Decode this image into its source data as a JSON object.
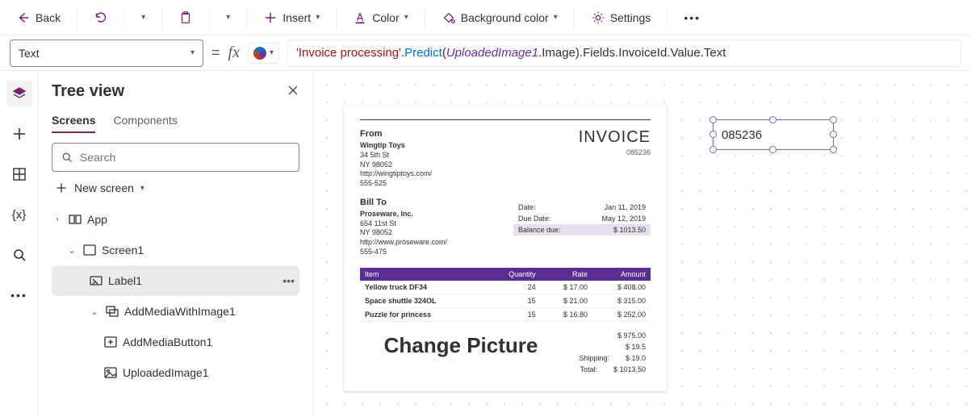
{
  "toolbar": {
    "back": "Back",
    "insert": "Insert",
    "color": "Color",
    "bgcolor": "Background color",
    "settings": "Settings"
  },
  "formula": {
    "property": "Text",
    "str": "'Invoice processing'",
    "dot1": ".",
    "fn": "Predict",
    "open": "(",
    "var": "UploadedImage1",
    "rest": ".Image).Fields.InvoiceId.Value.Text"
  },
  "panel": {
    "title": "Tree view",
    "tab_screens": "Screens",
    "tab_components": "Components",
    "search_placeholder": "Search",
    "new_screen": "New screen"
  },
  "tree": {
    "app": "App",
    "screen1": "Screen1",
    "label1": "Label1",
    "addmedia": "AddMediaWithImage1",
    "addbutton": "AddMediaButton1",
    "uploaded": "UploadedImage1"
  },
  "selected_value": "085236",
  "invoice": {
    "title": "INVOICE",
    "number": "085236",
    "from_label": "From",
    "from_lines": [
      "Wingtip Toys",
      "34 5th St",
      "NY 98052",
      "http://wingtiptoys.com/",
      "555-525"
    ],
    "bill_label": "Bill To",
    "bill_lines": [
      "Proseware, Inc.",
      "654 11st St",
      "NY 98052",
      "http://www.proseware.com/",
      "555-475"
    ],
    "date_label": "Date:",
    "date": "Jan 11, 2019",
    "due_label": "Due Date:",
    "due": "May 12, 2019",
    "balance_label": "Balance due:",
    "balance": "$ 1013.50",
    "cols": {
      "item": "Item",
      "qty": "Quantity",
      "rate": "Rate",
      "amount": "Amount"
    },
    "rows": [
      {
        "item": "Yellow truck DF34",
        "qty": "24",
        "rate": "$ 17.00",
        "amount": "$ 408.00"
      },
      {
        "item": "Space shuttle 324OL",
        "qty": "15",
        "rate": "$ 21.00",
        "amount": "$ 315.00"
      },
      {
        "item": "Puzzle for princess",
        "qty": "15",
        "rate": "$ 16.80",
        "amount": "$ 252.00"
      }
    ],
    "change": "Change Picture",
    "totals": [
      {
        "label": "",
        "value": "$ 975.00"
      },
      {
        "label": "",
        "value": "$ 19.5"
      },
      {
        "label": "Shipping:",
        "value": "$ 19.0"
      },
      {
        "label": "Total:",
        "value": "$ 1013.50"
      }
    ]
  }
}
